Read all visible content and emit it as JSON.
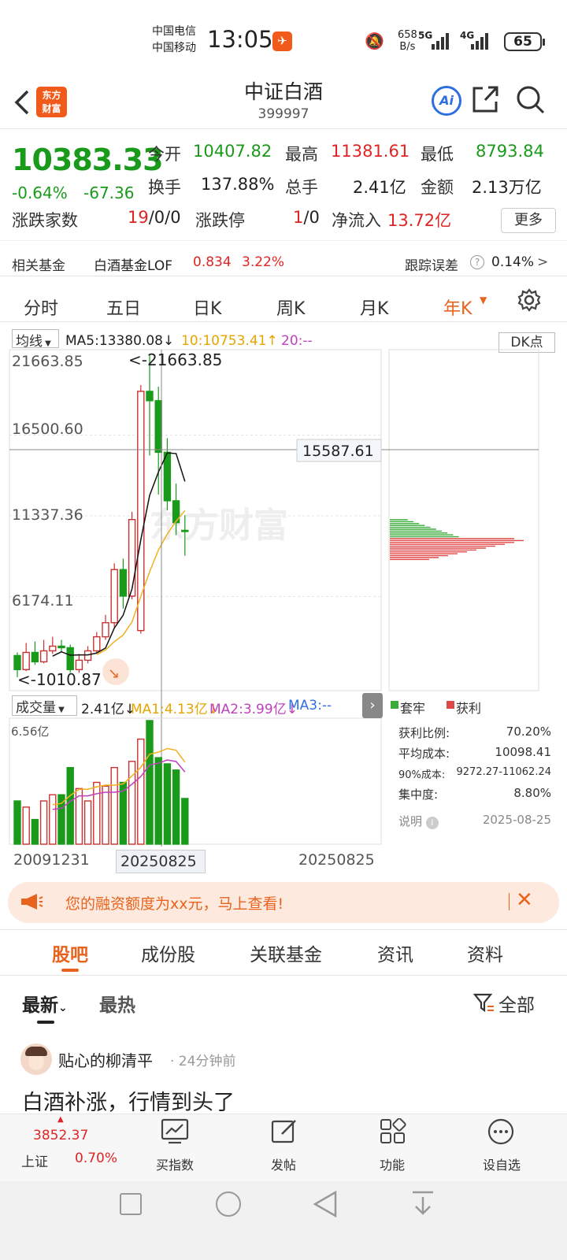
{
  "status_bar": {
    "carrier1": "中国电信",
    "carrier2": "中国移动",
    "time": "13:05",
    "net_speed_value": "658",
    "net_speed_unit": "B/s",
    "net1": "5G",
    "net2": "4G",
    "battery": "65"
  },
  "header": {
    "back_icon": "chevron-left-icon",
    "logo_line1": "东方",
    "logo_line2": "财富",
    "title": "中证白酒",
    "code": "399997",
    "ai_label": "Ai"
  },
  "quote": {
    "price": "10383.33",
    "change_pct": "-0.64%",
    "change_abs": "-67.36",
    "open_label": "今开",
    "open": "10407.82",
    "high_label": "最高",
    "high": "11381.61",
    "low_label": "最低",
    "low": "8793.84",
    "turnover_label": "换手",
    "turnover": "137.88%",
    "vol_label": "总手",
    "vol": "2.41亿",
    "amount_label": "金额",
    "amount": "2.13万亿",
    "updown_label": "涨跌家数",
    "updown_red": "19",
    "updown_rest": "/0/0",
    "limit_label": "涨跌停",
    "limit_red": "1",
    "limit_rest": "/0",
    "netflow_label": "净流入",
    "netflow": "13.72亿",
    "more_button": "更多"
  },
  "fund": {
    "label": "相关基金",
    "name": "白酒基金LOF",
    "price": "0.834",
    "pct": "3.22%",
    "tracking_label": "跟踪误差",
    "tracking_value": "0.14%",
    "chevron": ">"
  },
  "ktabs": [
    "分时",
    "五日",
    "日K",
    "周K",
    "月K",
    "年K"
  ],
  "ktab_active": "年K",
  "chart": {
    "ma_selector": "均线",
    "ma5": "MA5:13380.08↓",
    "ma10": "10:10753.41↑",
    "ma20": "20:--",
    "dk_label": "DK点",
    "y_labels": [
      "21663.85",
      "16500.60",
      "11337.36",
      "6174.11"
    ],
    "max_marker": "<-21663.85",
    "min_marker": "<-1010.87",
    "min_partial": "010.87",
    "crosshair_value": "15587.61",
    "watermark": "东方财富",
    "vol_selector": "成交量",
    "vol_value": "2.41亿↓",
    "vol_ma1": "MA1:4.13亿↓",
    "vol_ma2": "MA2:3.99亿↓",
    "vol_ma3": "MA3:--",
    "vol_max": "6.56亿",
    "x_start": "20091231",
    "x_cursor": "20250825",
    "x_end": "20250825",
    "legend_trapped": "套牢",
    "legend_profit": "获利",
    "colors": {
      "up": "#c83232",
      "down": "#1a9a1a",
      "ma5": "#111111",
      "ma10": "#f0b020",
      "ma20": "#c040c0"
    }
  },
  "chip_stats": {
    "profit_ratio_label": "获利比例:",
    "profit_ratio": "70.20%",
    "avg_cost_label": "平均成本:",
    "avg_cost": "10098.41",
    "cost90_label": "90%成本:",
    "cost90": "9272.27-11062.24",
    "concentration_label": "集中度:",
    "concentration": "8.80%",
    "note_label": "说明",
    "date": "2025-08-25"
  },
  "chart_data": {
    "type": "candlestick",
    "ylim": [
      1010.87,
      21663.85
    ],
    "candles_approx": [
      {
        "o": 2400,
        "c": 1500,
        "h": 2600,
        "l": 1010.87
      },
      {
        "o": 1500,
        "c": 2600,
        "h": 3200,
        "l": 1400
      },
      {
        "o": 2600,
        "c": 2000,
        "h": 3300,
        "l": 1800
      },
      {
        "o": 2000,
        "c": 2700,
        "h": 3400,
        "l": 1900
      },
      {
        "o": 2700,
        "c": 3000,
        "h": 3600,
        "l": 2500
      },
      {
        "o": 3000,
        "c": 2900,
        "h": 3400,
        "l": 2600
      },
      {
        "o": 2900,
        "c": 1500,
        "h": 3100,
        "l": 1300
      },
      {
        "o": 1500,
        "c": 2100,
        "h": 2500,
        "l": 1300
      },
      {
        "o": 2100,
        "c": 2700,
        "h": 3000,
        "l": 1900
      },
      {
        "o": 2700,
        "c": 3600,
        "h": 3900,
        "l": 2600
      },
      {
        "o": 3600,
        "c": 4500,
        "h": 5000,
        "l": 3400
      },
      {
        "o": 4500,
        "c": 7900,
        "h": 8300,
        "l": 4200
      },
      {
        "o": 7900,
        "c": 6200,
        "h": 8600,
        "l": 5400
      },
      {
        "o": 6200,
        "c": 11100,
        "h": 11600,
        "l": 6000
      },
      {
        "o": 4000,
        "c": 19300,
        "h": 19700,
        "l": 3800
      },
      {
        "o": 19300,
        "c": 18700,
        "h": 21663.85,
        "l": 15200
      },
      {
        "o": 18700,
        "c": 15400,
        "h": 19600,
        "l": 12700
      },
      {
        "o": 15400,
        "c": 12300,
        "h": 16300,
        "l": 11700
      },
      {
        "o": 12300,
        "c": 10900,
        "h": 13400,
        "l": 10100
      },
      {
        "o": 10407.82,
        "c": 10383.33,
        "h": 11381.61,
        "l": 8793.84
      }
    ],
    "volume_max": "6.56亿",
    "x_range": [
      "20091231",
      "20250825"
    ]
  },
  "promo": {
    "icon": "megaphone-icon",
    "text": "您的融资额度为xx元，马上查看!",
    "close_icon": "close-icon"
  },
  "forum_tabs": [
    "股吧",
    "成份股",
    "关联基金",
    "资讯",
    "资料"
  ],
  "forum_active": "股吧",
  "sort_tabs": {
    "latest": "最新",
    "hot": "最热",
    "filter": "全部"
  },
  "post": {
    "user": "贴心的柳清平",
    "time": "· 24分钟前",
    "content": "白酒补涨，行情到头了"
  },
  "bottom_bar": {
    "index_value": "3852.37",
    "index_name": "上证",
    "index_pct": "0.70%",
    "buy_index": "买指数",
    "post": "发帖",
    "function": "功能",
    "watch": "设自选"
  }
}
